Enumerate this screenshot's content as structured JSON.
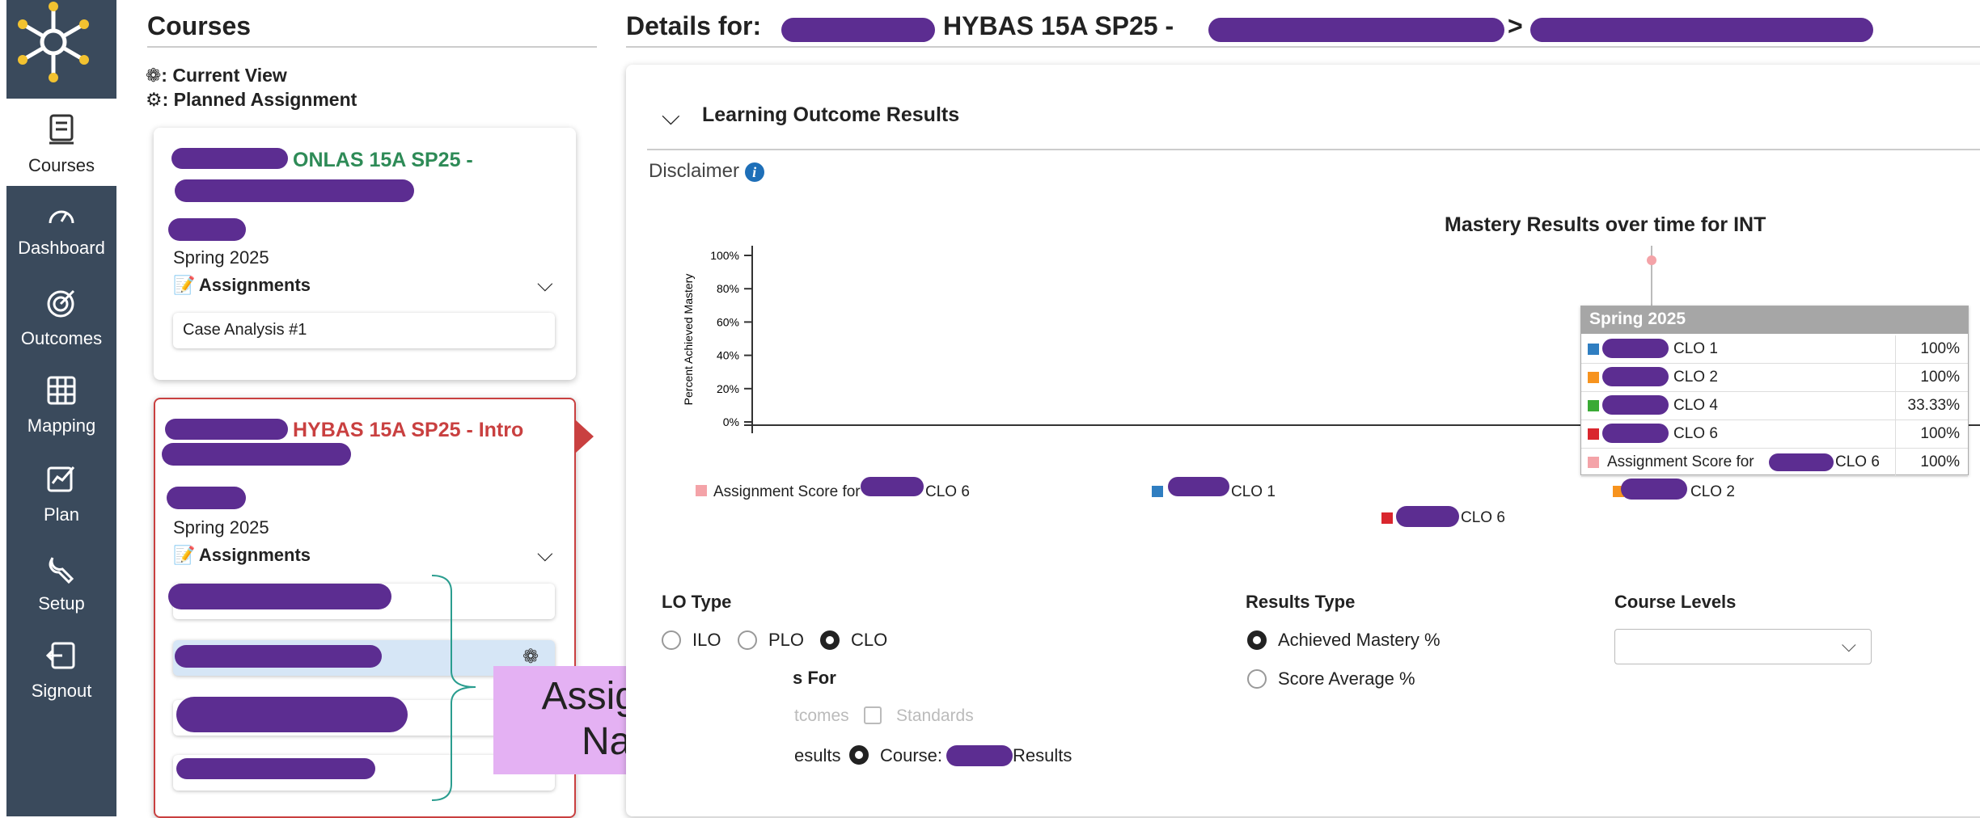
{
  "nav": {
    "items": [
      {
        "label": "Courses",
        "icon": "courses-icon"
      },
      {
        "label": "Dashboard",
        "icon": "dashboard-icon"
      },
      {
        "label": "Outcomes",
        "icon": "outcomes-icon"
      },
      {
        "label": "Mapping",
        "icon": "mapping-icon"
      },
      {
        "label": "Plan",
        "icon": "plan-icon"
      },
      {
        "label": "Setup",
        "icon": "setup-icon"
      },
      {
        "label": "Signout",
        "icon": "signout-icon"
      }
    ]
  },
  "courses": {
    "title": "Courses",
    "legend_current": ": Current View",
    "legend_planned": ": Planned Assignment",
    "card1": {
      "code": "ONLAS 15A SP25 -",
      "term": "Spring 2025",
      "assignments_label": "Assignments",
      "assignment1": "Case Analysis #1"
    },
    "card2": {
      "code": "HYBAS 15A SP25 - Intro",
      "term": "Spring 2025",
      "assignments_label": "Assignments"
    }
  },
  "details": {
    "prefix": "Details for:",
    "course": "HYBAS 15A SP25 -",
    "separator": ">",
    "section_title": "Learning Outcome Results",
    "disclaimer": "Disclaimer"
  },
  "chart_data": {
    "type": "scatter",
    "title": "Mastery Results over time for INT",
    "ylabel": "Percent Achieved Mastery",
    "yticks": [
      "0%",
      "20%",
      "40%",
      "60%",
      "80%",
      "100%"
    ],
    "ylim": [
      0,
      100
    ],
    "series": [
      {
        "name": "CLO 1",
        "color": "#2f7ec1",
        "values": [
          100
        ]
      },
      {
        "name": "CLO 2",
        "color": "#f7931e",
        "values": [
          100
        ]
      },
      {
        "name": "CLO 4",
        "color": "#3aaa35",
        "values": [
          33.33
        ]
      },
      {
        "name": "CLO 6",
        "color": "#d9262e",
        "values": [
          100
        ]
      },
      {
        "name": "Assignment Score for",
        "suffix": "CLO 6",
        "color": "#f4a3a8",
        "values": [
          100
        ]
      }
    ],
    "legend": [
      {
        "prefix": "Assignment Score for",
        "suffix": "CLO 6",
        "color": "#f4a3a8"
      },
      {
        "prefix": "",
        "suffix": "CLO 1",
        "color": "#2f7ec1"
      },
      {
        "prefix": "",
        "suffix": "CLO 2",
        "color": "#f7931e"
      },
      {
        "prefix": "",
        "suffix": "CLO 6",
        "color": "#d9262e"
      }
    ],
    "tooltip": {
      "header": "Spring 2025",
      "rows": [
        {
          "label": "CLO 1",
          "value": "100%",
          "color": "#2f7ec1"
        },
        {
          "label": "CLO 2",
          "value": "100%",
          "color": "#f7931e"
        },
        {
          "label": "CLO 4",
          "value": "33.33%",
          "color": "#3aaa35"
        },
        {
          "label": "CLO 6",
          "value": "100%",
          "color": "#d9262e"
        },
        {
          "label": "Assignment Score for",
          "label_suffix": "CLO 6",
          "value": "100%",
          "color": "#f4a3a8"
        }
      ]
    }
  },
  "filters": {
    "lo_type_label": "LO Type",
    "lo_types": [
      "ILO",
      "PLO",
      "CLO"
    ],
    "results_for_label": "s For",
    "outcomes_label": "tcomes",
    "standards_label": "Standards",
    "results_left": "esults",
    "course_label": "Course:",
    "course_results": "Results",
    "results_type_label": "Results Type",
    "results_types": [
      "Achieved Mastery %",
      "Score Average %"
    ],
    "course_levels_label": "Course Levels"
  },
  "annotation": {
    "line1": "Assignment",
    "line2": "Names"
  }
}
